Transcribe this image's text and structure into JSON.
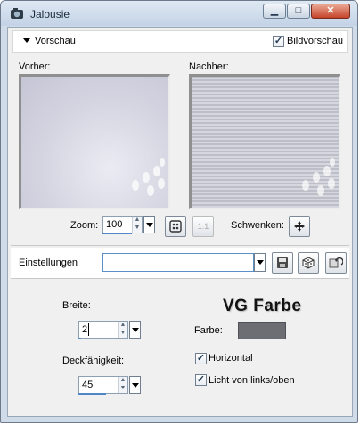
{
  "window": {
    "title": "Jalousie",
    "caption_buttons": {
      "minimize": "▁",
      "maximize": "□",
      "close": "✕"
    }
  },
  "preview_bar": {
    "toggle_label": "Vorschau",
    "bild_label": "Bildvorschau",
    "bild_checked": true
  },
  "panels": {
    "before_label": "Vorher:",
    "after_label": "Nachher:"
  },
  "zoom": {
    "label": "Zoom:",
    "value": "100",
    "pan_label": "Schwenken:",
    "zoom_ratio_label": "1:1"
  },
  "settings": {
    "label": "Einstellungen",
    "value": ""
  },
  "params": {
    "width_label": "Breite:",
    "width_value": "2",
    "opacity_label": "Deckfähigkeit:",
    "opacity_value": "45",
    "color_label": "Farbe:",
    "color_value": "#6d6d74",
    "horizontal_label": "Horizontal",
    "horizontal_checked": true,
    "light_label": "Licht von links/oben",
    "light_checked": true
  },
  "annotation": {
    "text": "VG Farbe"
  }
}
